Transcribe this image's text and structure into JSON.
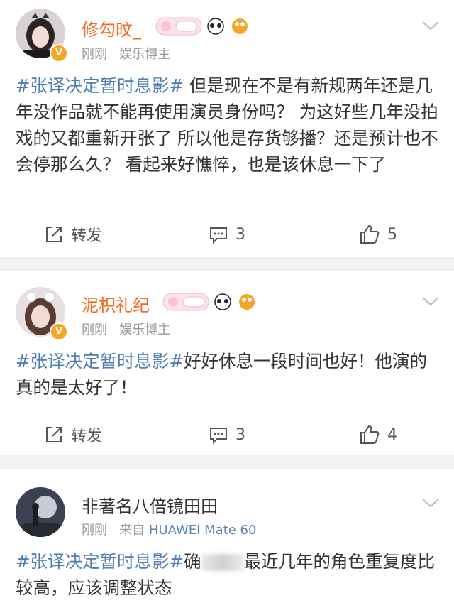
{
  "posts": [
    {
      "username": "修勾旼_",
      "time": "刚刚",
      "role": "娱乐博主",
      "hashtag": "#张译决定暂时息影#",
      "text": " 但是现在不是有新规两年还是几年没作品就不能再使用演员身份吗？ 为这好些几年没拍戏的又都重新开张了 所以他是存货够播？还是预计也不会停那么久？ 看起来好憔悴，也是该休息一下了",
      "repost_label": "转发",
      "comments": "3",
      "likes": "5",
      "verified_badge": "V"
    },
    {
      "username": "泥枳礼纪",
      "time": "刚刚",
      "role": "娱乐博主",
      "hashtag": "#张译决定暂时息影#",
      "text": "好好休息一段时间也好！他演的真的是太好了！",
      "repost_label": "转发",
      "comments": "3",
      "likes": "4",
      "verified_badge": "V"
    },
    {
      "username": "非著名八倍镜田田",
      "time": "刚刚",
      "source_prefix": "来自",
      "source": "HUAWEI Mate 60",
      "hashtag": "#张译决定暂时息影#",
      "text_a": "确",
      "text_b": "最近几年的角色重复度比较高，应该调整状态"
    }
  ],
  "colors": {
    "username_vip": "#f26d21",
    "hashtag": "#4f7eb3",
    "meta": "#999999",
    "verified": "#f5a623",
    "separator": "#f2f2f2"
  }
}
